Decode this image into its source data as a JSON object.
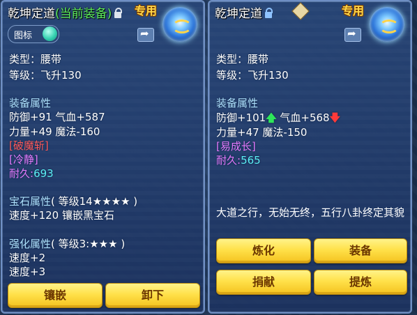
{
  "left": {
    "title": "乾坤定道",
    "current_tag": "(当前装备)",
    "exclusive": "专用",
    "toggle_label": "图标",
    "type_line": "类型：腰带",
    "level_line": "等级：飞升130",
    "equip_attr_title": "装备属性",
    "attr_line1": "防御+91 气血+587",
    "attr_line2": "力量+49 魔法-160",
    "special1": "[破魔斩]",
    "special2": "[冷静]",
    "durability_label": "耐久:",
    "durability_value": "693",
    "gem_title": "宝石属性",
    "gem_level": "( 等级14★★★★ )",
    "gem_line": "速度+120 镶嵌黑宝石",
    "enhance_title": "强化属性",
    "enhance_level": "( 等级3:★★★ )",
    "enhance_line1": "速度+2",
    "enhance_line2": "速度+3",
    "buttons": [
      "镶嵌",
      "卸下"
    ]
  },
  "right": {
    "title": "乾坤定道",
    "exclusive": "专用",
    "type_line": "类型：腰带",
    "level_line": "等级：飞升130",
    "equip_attr_title": "装备属性",
    "attr_defense": "防御+101",
    "attr_hp": "气血+568",
    "attr_line2": "力量+47 魔法-150",
    "special1": "[易成长]",
    "durability_label": "耐久:",
    "durability_value": "565",
    "description": "大道之行，无始无终，五行八卦终定其貌",
    "buttons": [
      "炼化",
      "装备",
      "捐献",
      "提炼"
    ]
  },
  "colors": {
    "accent_gold": "#ffd84a",
    "stat_up": "#2ee65a",
    "stat_down": "#ff3a3a",
    "special_red": "#ff5a5a",
    "special_purple": "#e67bff",
    "durability_cyan": "#5cf0f5",
    "section_blue": "#aee2ff"
  },
  "icons": [
    "lock-icon",
    "share-icon",
    "item-icon",
    "compare-badge-icon",
    "arrow-up-icon",
    "arrow-down-icon"
  ]
}
